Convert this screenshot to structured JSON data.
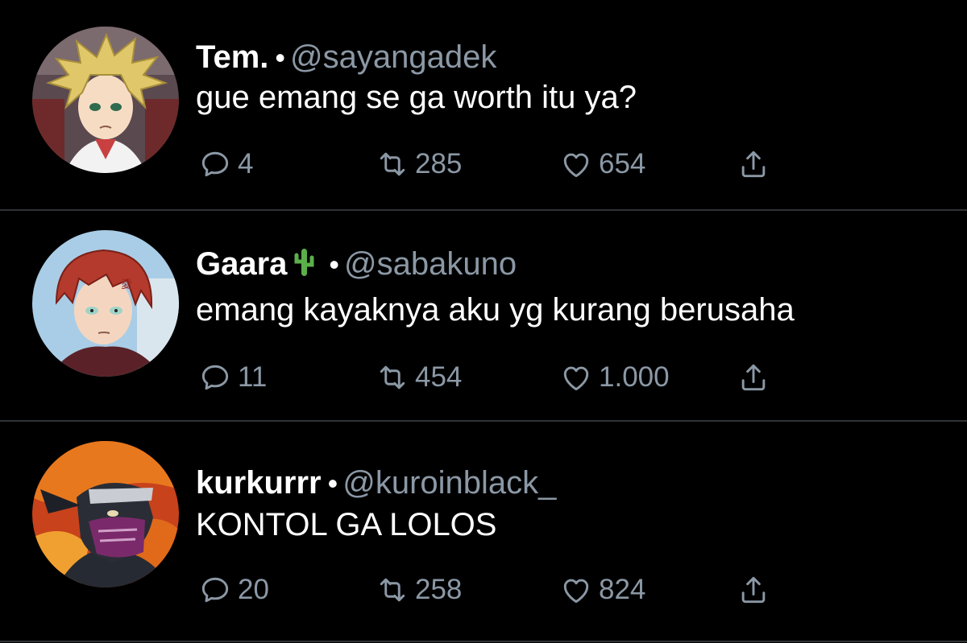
{
  "tweets": [
    {
      "display_name": "Tem.",
      "separator": "•",
      "handle": "@sayangadek",
      "text": "gue emang se ga worth itu ya?",
      "replies": "4",
      "retweets": "285",
      "likes": "654",
      "avatar": "blonde-anime-girl-avatar"
    },
    {
      "display_name": "Gaara",
      "name_emoji": "cactus",
      "separator": "•",
      "handle": "@sabakuno",
      "text": "emang kayaknya aku yg kurang berusaha",
      "replies": "11",
      "retweets": "454",
      "likes": "1.000",
      "avatar": "red-haired-anime-boy-avatar"
    },
    {
      "display_name": "kurkurrr",
      "separator": "•",
      "handle": "@kuroinblack_",
      "text": "KONTOL GA LOLOS",
      "replies": "20",
      "retweets": "258",
      "likes": "824",
      "avatar": "masked-anime-ninja-avatar"
    }
  ],
  "icons": {
    "reply": "reply-bubble-icon",
    "retweet": "retweet-icon",
    "like": "heart-icon",
    "share": "share-upload-icon"
  },
  "colors": {
    "background": "#000000",
    "text": "#ffffff",
    "muted": "#8b98a5",
    "divider": "#2f3336"
  }
}
